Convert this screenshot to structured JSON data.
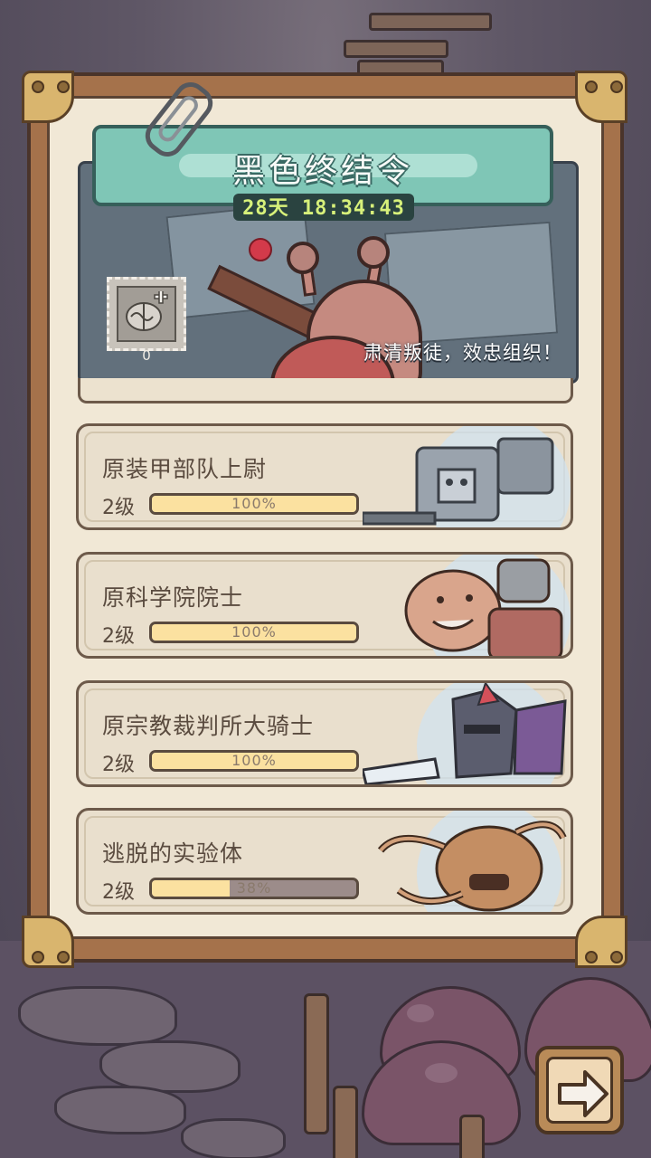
{
  "event": {
    "title": "黑色终结令",
    "countdown": "28天 18:34:43",
    "slogan": "肃清叛徒，效忠组织！",
    "item_count": "0",
    "item_icon": "brain-plus-icon"
  },
  "cards": [
    {
      "name": "原装甲部队上尉",
      "level": "2级",
      "progress_text": "100%",
      "progress": 1.0,
      "portrait": "mech-soldier"
    },
    {
      "name": "原科学院院士",
      "level": "2级",
      "progress_text": "100%",
      "progress": 1.0,
      "portrait": "cyborg-scientist"
    },
    {
      "name": "原宗教裁判所大骑士",
      "level": "2级",
      "progress_text": "100%",
      "progress": 1.0,
      "portrait": "dark-knight"
    },
    {
      "name": "逃脱的实验体",
      "level": "2级",
      "progress_text": "38%",
      "progress": 0.38,
      "portrait": "tentacle-creature"
    }
  ],
  "next_button": {
    "icon": "arrow-right-icon"
  },
  "colors": {
    "title_plate": "#7fc6b6",
    "timer_text": "#d7f07a",
    "bar_fill": "#fbe1a0",
    "bar_empty": "#9c8c8a",
    "card_bg": "#e9dfcd"
  }
}
